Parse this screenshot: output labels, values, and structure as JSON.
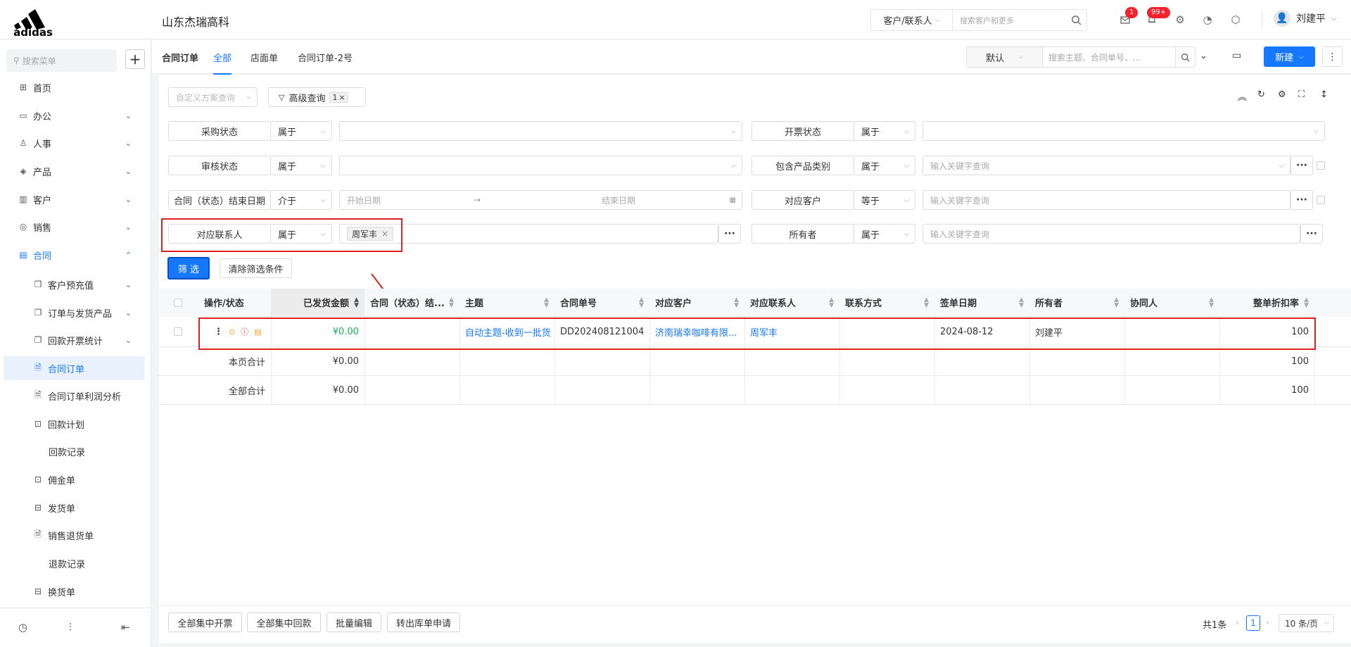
{
  "header": {
    "company": "山东杰瑞高科",
    "search_scope": "客户/联系人",
    "search_placeholder": "搜索客户和更多",
    "mail_badge": "1",
    "bell_badge": "99+",
    "user_name": "刘建平"
  },
  "sidebar": {
    "search_placeholder": "搜索菜单",
    "items": [
      {
        "label": "首页",
        "icon": "home-icon"
      },
      {
        "label": "办公",
        "icon": "office-icon"
      },
      {
        "label": "人事",
        "icon": "people-icon"
      },
      {
        "label": "产品",
        "icon": "box-icon"
      },
      {
        "label": "客户",
        "icon": "building-icon"
      },
      {
        "label": "销售",
        "icon": "target-icon"
      },
      {
        "label": "合同",
        "icon": "contract-icon"
      },
      {
        "label": "客户预充值",
        "icon": "copy-icon"
      },
      {
        "label": "订单与发货产品",
        "icon": "copy-icon"
      },
      {
        "label": "回款开票统计",
        "icon": "copy-icon"
      },
      {
        "label": "合同订单",
        "icon": "doc-icon"
      },
      {
        "label": "合同订单利润分析",
        "icon": "doc-icon"
      },
      {
        "label": "回款计划",
        "icon": "doc-icon"
      },
      {
        "label": "回款记录",
        "icon": ""
      },
      {
        "label": "佣金单",
        "icon": "doc-icon"
      },
      {
        "label": "发货单",
        "icon": "truck-icon"
      },
      {
        "label": "销售退货单",
        "icon": "doc-icon"
      },
      {
        "label": "退款记录",
        "icon": ""
      },
      {
        "label": "换货单",
        "icon": "doc-icon"
      }
    ]
  },
  "tabs": {
    "title": "合同订单",
    "items": [
      "全部",
      "店面单",
      "合同订单-2号"
    ],
    "view": "默认",
    "search_placeholder": "搜索主题、合同单号、...",
    "new_label": "新建"
  },
  "filters": {
    "custom_scheme": "自定义方案查询",
    "advanced": "高级查询",
    "advanced_count": "1",
    "rows": [
      {
        "label": "采购状态",
        "op": "属于",
        "value": ""
      },
      {
        "label": "开票状态",
        "op": "属于",
        "value": ""
      },
      {
        "label": "审核状态",
        "op": "属于",
        "value": ""
      },
      {
        "label": "包含产品类别",
        "op": "属于",
        "value": "输入关键字查询"
      },
      {
        "label": "合同（状态）结束日期",
        "op": "介于",
        "start": "开始日期",
        "end": "结束日期"
      },
      {
        "label": "对应客户",
        "op": "等于",
        "value": "输入关键字查询"
      },
      {
        "label": "对应联系人",
        "op": "属于",
        "tag": "周军丰"
      },
      {
        "label": "所有者",
        "op": "属于",
        "value": "输入关键字查询"
      }
    ],
    "filter_btn": "筛 选",
    "clear_btn": "清除筛选条件"
  },
  "table": {
    "columns": [
      "操作/状态",
      "已发货金额",
      "合同（状态）结...",
      "主题",
      "合同单号",
      "对应客户",
      "对应联系人",
      "联系方式",
      "签单日期",
      "所有者",
      "协同人",
      "整单折扣率"
    ],
    "rows": [
      {
        "shipped": "¥0.00",
        "end": "",
        "subject": "自动主题-收到一批货",
        "no": "DD202408121004",
        "customer": "济南瑞幸咖啡有限...",
        "contact": "周军丰",
        "phone": "",
        "date": "2024-08-12",
        "owner": "刘建平",
        "collab": "",
        "discount": "100"
      }
    ],
    "page_total_label": "本页合计",
    "page_total_amount": "¥0.00",
    "page_total_discount": "100",
    "all_total_label": "全部合计",
    "all_total_amount": "¥0.00",
    "all_total_discount": "100"
  },
  "footer": {
    "buttons": [
      "全部集中开票",
      "全部集中回款",
      "批量编辑",
      "转出库单申请"
    ],
    "total": "共1条",
    "page": "1",
    "page_size": "10 条/页"
  }
}
